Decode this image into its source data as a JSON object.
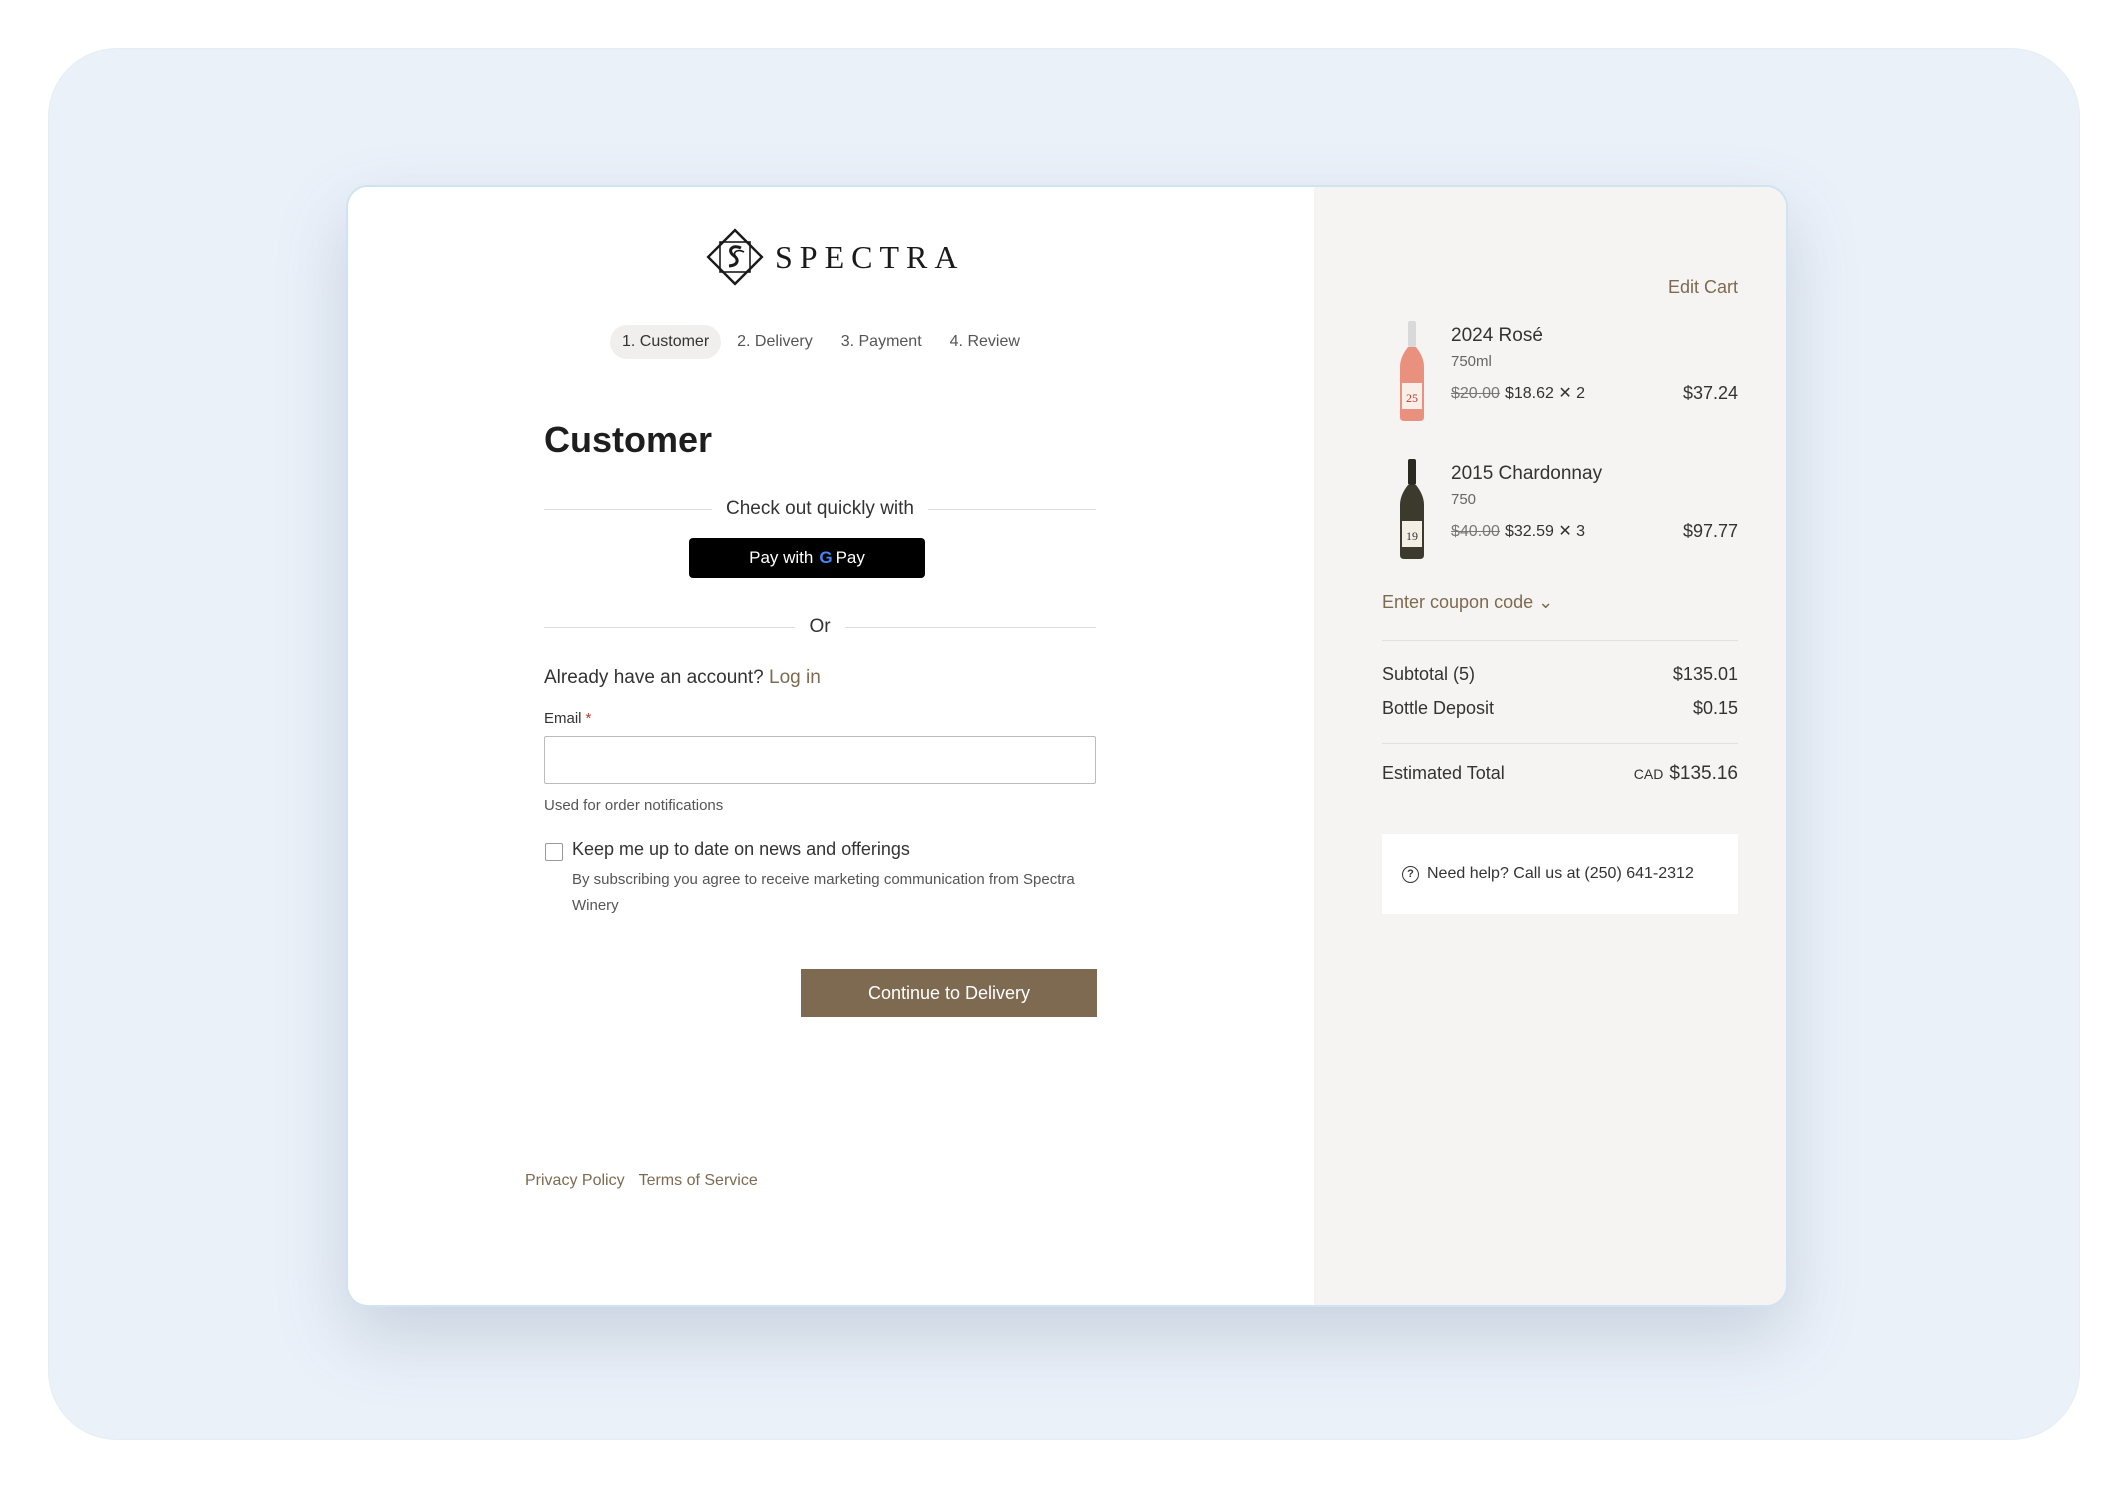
{
  "brand": {
    "name": "SPECTRA"
  },
  "steps": [
    {
      "label": "1. Customer",
      "active": true
    },
    {
      "label": "2. Delivery",
      "active": false
    },
    {
      "label": "3. Payment",
      "active": false
    },
    {
      "label": "4. Review",
      "active": false
    }
  ],
  "form": {
    "heading": "Customer",
    "quick_checkout_label": "Check out quickly with",
    "gpay": {
      "prefix": "Pay with",
      "g": "G",
      "pay": "Pay"
    },
    "or_label": "Or",
    "account_prompt": "Already have an account?",
    "login_label": "Log in",
    "email_label": "Email",
    "email_required": "*",
    "email_value": "",
    "email_help": "Used for order notifications",
    "newsletter_label": "Keep me up to date on news and offerings",
    "newsletter_checked": false,
    "newsletter_desc": "By subscribing you agree to receive marketing communication from Spectra Winery",
    "continue_label": "Continue to Delivery"
  },
  "footer": {
    "privacy": "Privacy Policy",
    "terms": "Terms of Service"
  },
  "cart": {
    "edit_label": "Edit Cart",
    "items": [
      {
        "name": "2024 Rosé",
        "size": "750ml",
        "old_price": "$20.00",
        "unit_qty": "$18.62 ✕ 2",
        "total": "$37.24",
        "bottle_color": "#e9907f",
        "label_num": "25"
      },
      {
        "name": "2015 Chardonnay",
        "size": "750",
        "old_price": "$40.00",
        "unit_qty": "$32.59 ✕ 3",
        "total": "$97.77",
        "bottle_color": "#3b3a2c",
        "label_num": "19"
      }
    ],
    "coupon_label": "Enter coupon code ⌄",
    "subtotal_label": "Subtotal (5)",
    "subtotal_value": "$135.01",
    "deposit_label": "Bottle Deposit",
    "deposit_value": "$0.15",
    "total_label": "Estimated Total",
    "total_currency": "CAD",
    "total_value": "$135.16",
    "help_text": "Need help? Call us at (250) 641-2312"
  }
}
